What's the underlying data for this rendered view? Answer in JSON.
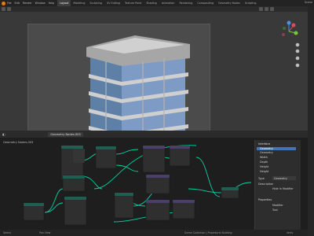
{
  "topbar": {
    "menus": [
      "File",
      "Edit",
      "Render",
      "Window",
      "Help"
    ],
    "tabs": [
      "Layout",
      "Modeling",
      "Sculpting",
      "UV Editing",
      "Texture Paint",
      "Shading",
      "Animation",
      "Rendering",
      "Compositing",
      "Geometry Nodes",
      "Scripting"
    ],
    "active_tab": 0,
    "scene_label": "Scene"
  },
  "node_editor": {
    "tree_name": "Geometry Nodes.003",
    "breadcrumb": "Geometry Nodes.003",
    "panel": {
      "section_title": "Interface",
      "items": [
        "Geometry",
        "Geometry",
        "Width",
        "Depth",
        "Height",
        "Height"
      ],
      "type_label": "Type",
      "type_value": "Geometry",
      "description_label": "Description",
      "hide_in_modifier_label": "Hide in Modifier",
      "properties_title": "Properties",
      "modifier_label": "Modifier",
      "tool_label": "Tool"
    }
  },
  "status": {
    "left": "Select",
    "middle": "Pan View",
    "right_a": "Scene Collection | Procedural Building",
    "right_b": "Verts"
  },
  "colors": {
    "accent": "#e87d0d",
    "link": "#00d6a3",
    "node_body": "#2f2f2f",
    "node_header": "#1f5f52",
    "window_glass": "#6f8fb7"
  }
}
